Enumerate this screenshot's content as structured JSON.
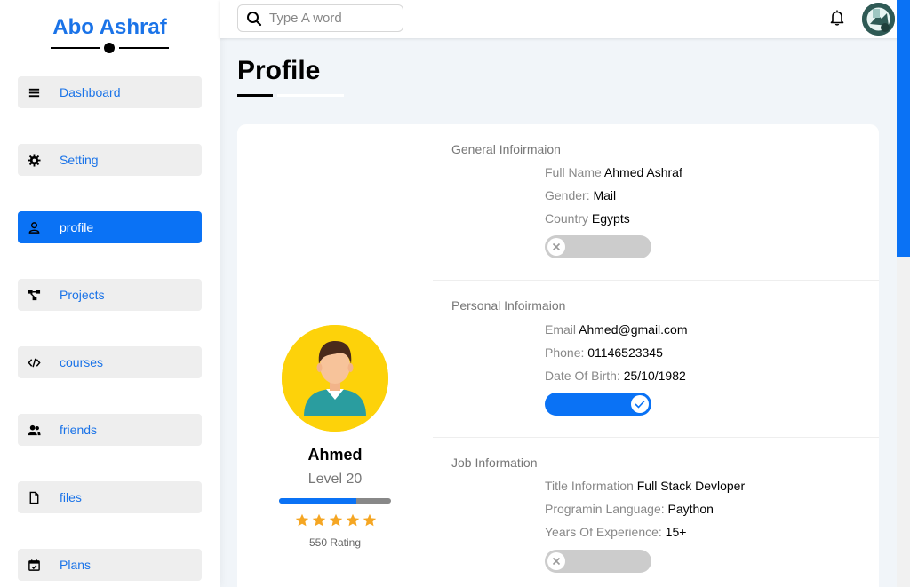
{
  "brand": {
    "name": "Abo Ashraf"
  },
  "sidebar": {
    "items": [
      {
        "label": "Dashboard",
        "icon": "menu-icon"
      },
      {
        "label": "Setting",
        "icon": "gear-icon"
      },
      {
        "label": "profile",
        "icon": "user-icon",
        "active": true
      },
      {
        "label": "Projects",
        "icon": "diagram-icon"
      },
      {
        "label": "courses",
        "icon": "code-icon"
      },
      {
        "label": "friends",
        "icon": "users-icon"
      },
      {
        "label": "files",
        "icon": "file-icon"
      },
      {
        "label": "Plans",
        "icon": "calendar-check-icon"
      }
    ]
  },
  "header": {
    "search_placeholder": "Type A word"
  },
  "page": {
    "title": "Profile"
  },
  "profile": {
    "name": "Ahmed",
    "level": "Level 20",
    "level_progress": 0.69,
    "stars": 5,
    "rating_text": "550 Rating"
  },
  "sections": {
    "general": {
      "title": "General Infoirmaion",
      "full_name_label": "Full Name",
      "full_name": "Ahmed Ashraf",
      "gender_label": "Gender:",
      "gender": "Mail",
      "country_label": "Country",
      "country": "Egypts",
      "toggle_on": false
    },
    "personal": {
      "title": "Personal Infoirmaion",
      "email_label": "Email",
      "email": "Ahmed@gmail.com",
      "phone_label": "Phone:",
      "phone": "01146523345",
      "dob_label": "Date Of Birth:",
      "dob": "25/10/1982",
      "toggle_on": true
    },
    "job": {
      "title": "Job Information",
      "title_info_label": "Title Information",
      "title_info": "Full Stack Devloper",
      "language_label": "Programin Language:",
      "language": "Paython",
      "experience_label": "Years Of Experience:",
      "experience": "15+",
      "toggle_on": false
    }
  },
  "colors": {
    "accent": "#0a72f5",
    "brand": "#1a73e8",
    "star": "#f5a623",
    "avatar_bg": "#fdd20a"
  }
}
